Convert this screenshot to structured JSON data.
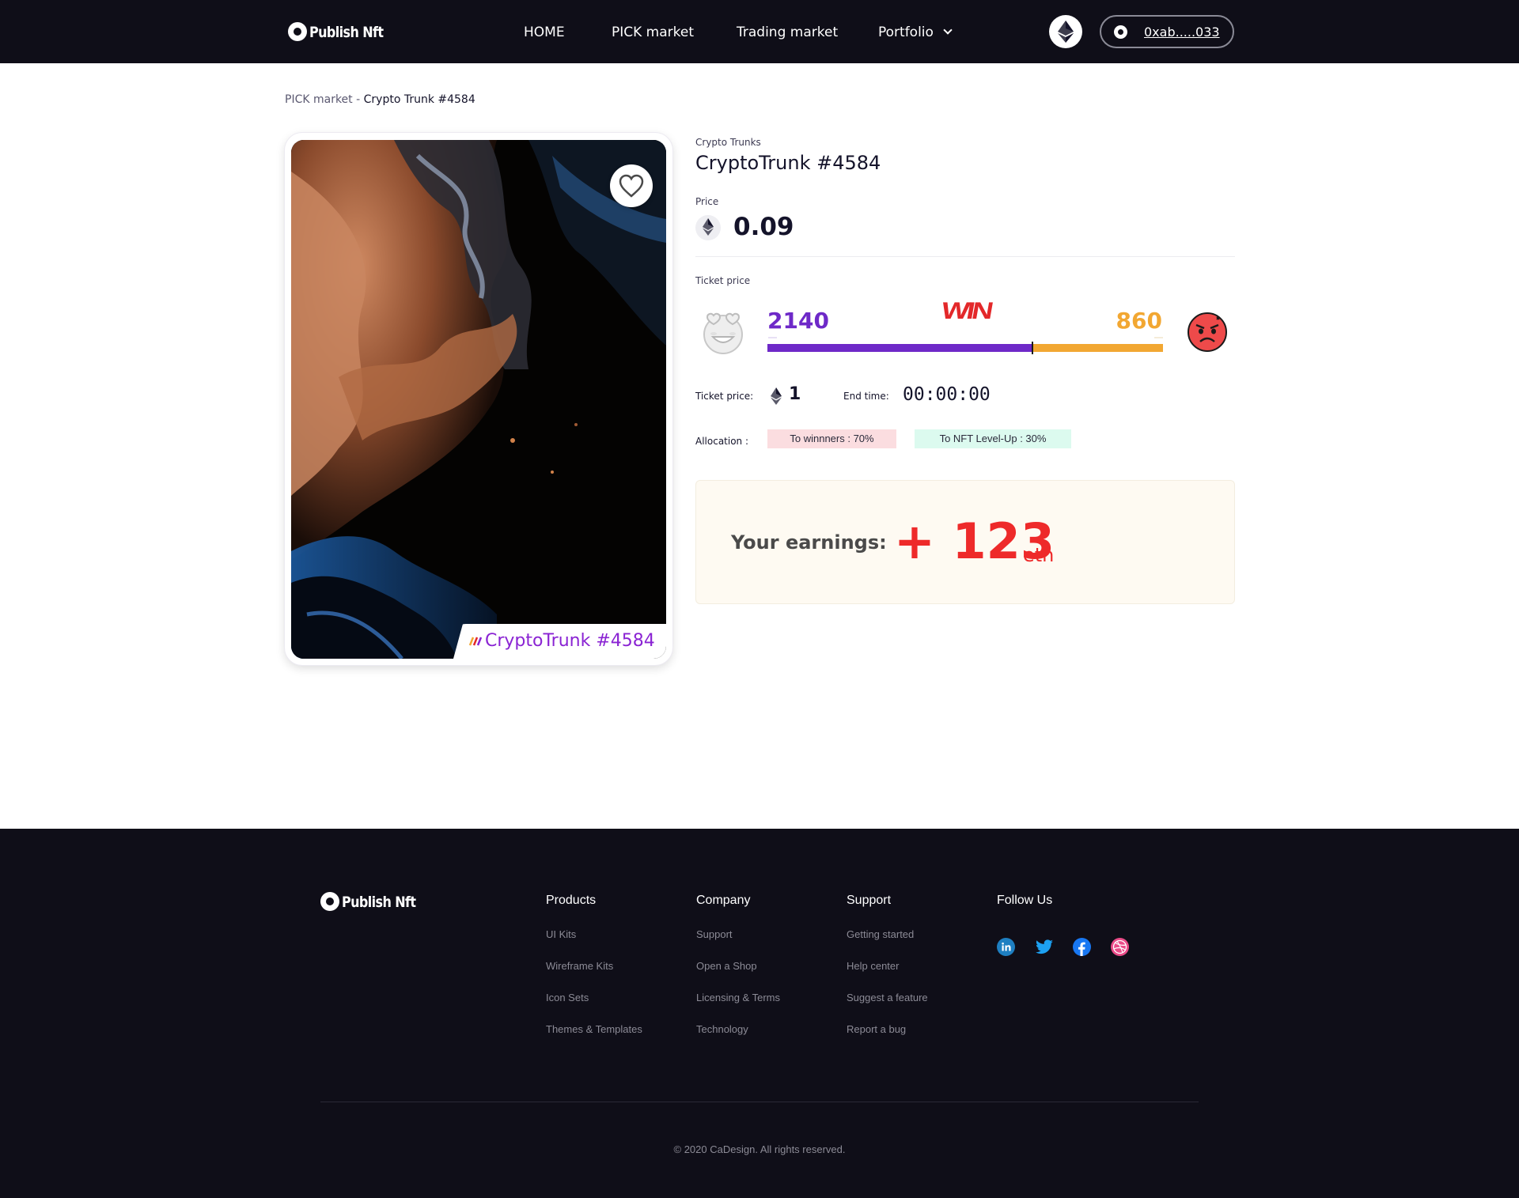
{
  "brand": {
    "name": "Publish Nft"
  },
  "nav": {
    "items": [
      {
        "label": "HOME"
      },
      {
        "label": "PICK market"
      },
      {
        "label": "Trading market"
      },
      {
        "label": "Portfolio"
      }
    ]
  },
  "wallet": {
    "address": "0xab.....033"
  },
  "breadcrumb": {
    "parent": "PICK market",
    "separator": " - ",
    "current": "Crypto Trunk #4584"
  },
  "nft": {
    "collection": "Crypto Trunks",
    "title": "CryptoTrunk #4584",
    "card_label": "CryptoTrunk #4584",
    "price_label": "Price",
    "price": "0.09"
  },
  "ticket": {
    "section_label": "Ticket price",
    "left_count": "2140",
    "right_count": "860",
    "win_label": "WIN",
    "left_share": 0.67,
    "ticket_price_label": "Ticket price:",
    "ticket_price": "1",
    "end_time_label": "End time:",
    "end_time": "00:00:00"
  },
  "allocation": {
    "label": "Allocation :",
    "winners": "To winnners : 70%",
    "levelup": "To NFT Level-Up : 30%"
  },
  "earnings": {
    "label": "Your earnings:",
    "value": "+ 123",
    "unit": "eth"
  },
  "footer": {
    "columns": [
      {
        "title": "Products",
        "items": [
          "UI Kits",
          "Wireframe Kits",
          "Icon Sets",
          "Themes & Templates"
        ]
      },
      {
        "title": "Company",
        "items": [
          "Support",
          "Open a Shop",
          "Licensing & Terms",
          "Technology"
        ]
      },
      {
        "title": "Support",
        "items": [
          "Getting started",
          "Help center",
          "Suggest a feature",
          "Report a bug"
        ]
      },
      {
        "title": "Follow Us",
        "items": []
      }
    ],
    "socials": [
      "linkedin-icon",
      "twitter-icon",
      "facebook-icon",
      "dribbble-icon"
    ],
    "copyright": "© 2020 CaDesign. All rights reserved."
  },
  "colors": {
    "header_bg": "#0f0e18",
    "purple": "#6e29c8",
    "orange": "#f2a732",
    "red": "#ee2a2a",
    "card_label": "#8a23d3"
  }
}
